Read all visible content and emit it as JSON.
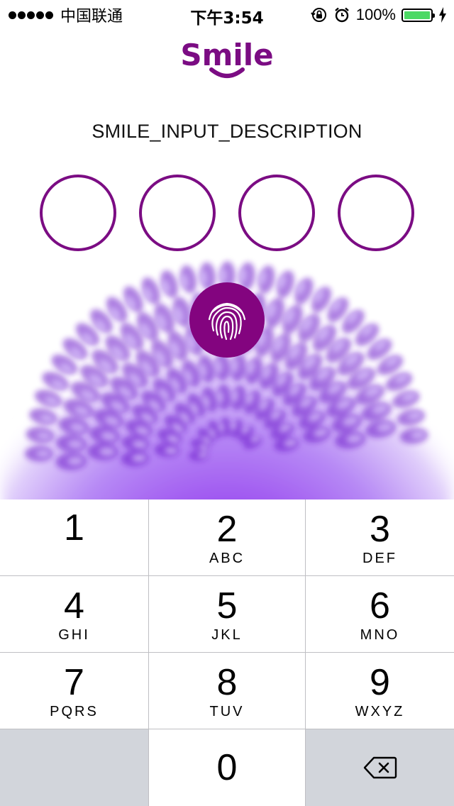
{
  "status_bar": {
    "carrier": "中国联通",
    "time": "下午3:54",
    "battery_percent": "100%",
    "battery_level": 1.0,
    "battery_color": "#4cd964"
  },
  "header": {
    "logo_text": "Smile",
    "brand_color": "#7b0c83"
  },
  "prompt": {
    "description": "SMILE_INPUT_DESCRIPTION"
  },
  "pin": {
    "length": 4,
    "filled": 0
  },
  "touch_id": {
    "icon": "fingerprint-icon",
    "color": "#83047f"
  },
  "keypad": {
    "keys": [
      {
        "digit": "1",
        "letters": ""
      },
      {
        "digit": "2",
        "letters": "ABC"
      },
      {
        "digit": "3",
        "letters": "DEF"
      },
      {
        "digit": "4",
        "letters": "GHI"
      },
      {
        "digit": "5",
        "letters": "JKL"
      },
      {
        "digit": "6",
        "letters": "MNO"
      },
      {
        "digit": "7",
        "letters": "PQRS"
      },
      {
        "digit": "8",
        "letters": "TUV"
      },
      {
        "digit": "9",
        "letters": "WXYZ"
      },
      {
        "digit": "0",
        "letters": ""
      }
    ],
    "delete_icon": "backspace-icon"
  }
}
